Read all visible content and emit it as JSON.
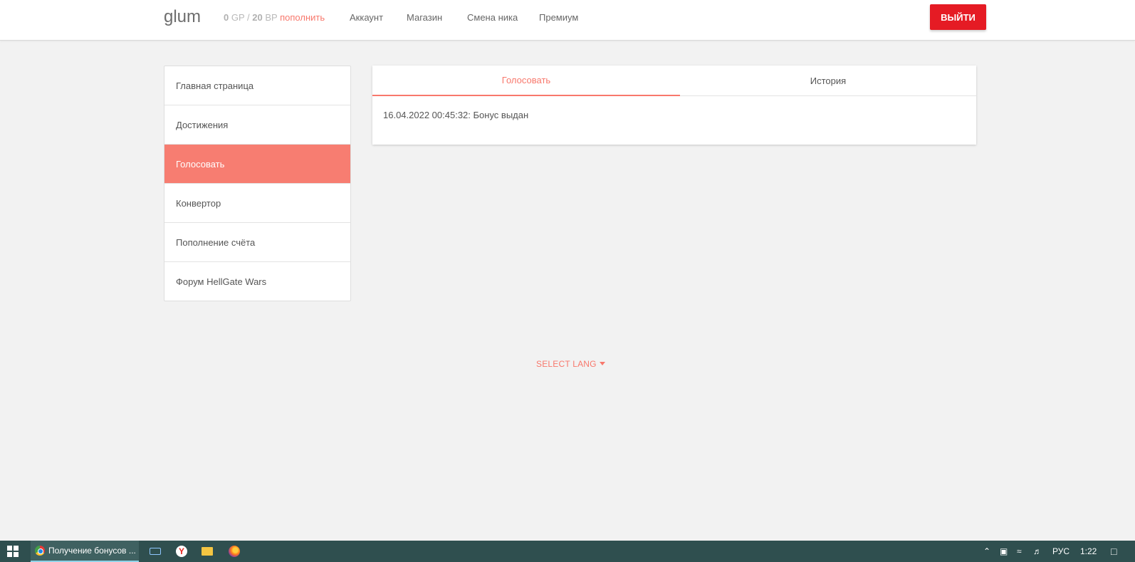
{
  "header": {
    "logo": "glum",
    "balance": {
      "gp_value": "0",
      "gp_unit": "GP",
      "separator": "/",
      "bp_value": "20",
      "bp_unit": "BP",
      "topup_label": "пополнить"
    },
    "nav": [
      {
        "label": "Аккаунт"
      },
      {
        "label": "Магазин"
      },
      {
        "label": "Смена ника"
      },
      {
        "label": "Премиум"
      }
    ],
    "logout_label": "ВЫЙТИ",
    "accent_color": "#f8786c",
    "logout_color": "#e51b24"
  },
  "sidebar": {
    "items": [
      {
        "label": "Главная страница",
        "active": false
      },
      {
        "label": "Достижения",
        "active": false
      },
      {
        "label": "Голосовать",
        "active": true
      },
      {
        "label": "Конвертор",
        "active": false
      },
      {
        "label": "Пополнение счёта",
        "active": false
      },
      {
        "label": "Форум HellGate Wars",
        "active": false
      }
    ]
  },
  "main": {
    "tabs": [
      {
        "label": "Голосовать",
        "active": true
      },
      {
        "label": "История",
        "active": false
      }
    ],
    "entries": [
      "16.04.2022 00:45:32: Бонус выдан"
    ]
  },
  "footer": {
    "lang_label": "SELECT LANG"
  },
  "taskbar": {
    "active_app_label": "Получение бонусов ...",
    "icons": [
      "windows-start-icon",
      "chrome-icon",
      "keyboard-icon",
      "yandex-browser-icon",
      "file-explorer-icon",
      "firefox-icon"
    ],
    "tray": {
      "lang": "РУС",
      "time": "1:22"
    }
  }
}
